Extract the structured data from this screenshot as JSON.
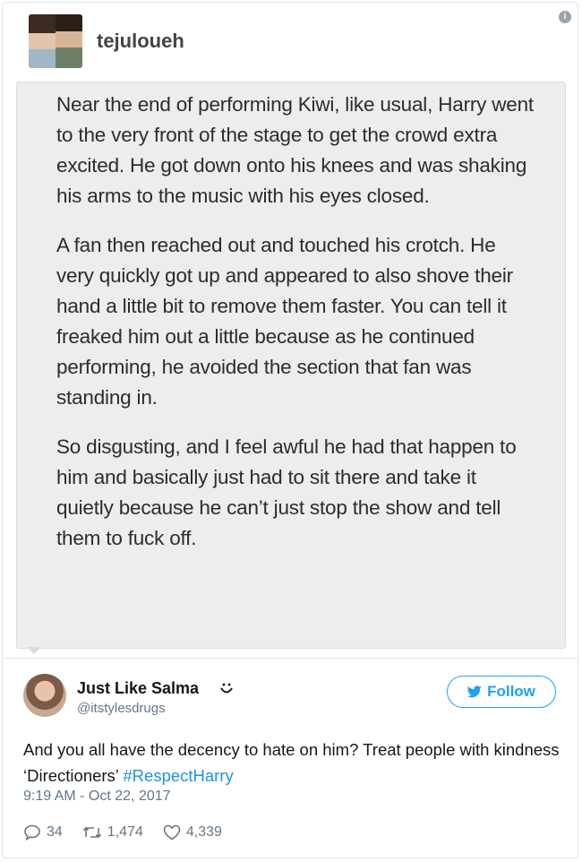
{
  "tumblr_post": {
    "username": "tejuloueh",
    "info_glyph": "i",
    "paragraphs": [
      "Near the end of performing Kiwi, like usual, Harry went to the very front of the stage to get the crowd extra excited. He got down onto his knees and was shaking his arms to the music with his eyes closed.",
      "A fan then reached out and touched his crotch. He very quickly got up and appeared to also shove their hand a little bit to remove them faster. You can tell it freaked him out a little because as he continued performing, he avoided the section that fan was standing in.",
      "So disgusting, and I feel awful he had that happen to him and basically just had to sit there and take it quietly because he can’t just stop the show and tell them to fuck off."
    ]
  },
  "tweet": {
    "display_name": "Just Like Salma",
    "handle": "@itstylesdrugs",
    "follow_label": "Follow",
    "text_main": "And you all have the decency to hate on him? Treat people with kindness ‘Directioners’ ",
    "hashtag": "#RespectHarry",
    "timestamp": "9:19 AM - Oct 22, 2017",
    "replies": "34",
    "retweets": "1,474",
    "likes": "4,339"
  },
  "icons": [
    "info-icon",
    "smile-icon",
    "twitter-bird-icon",
    "reply-icon",
    "retweet-icon",
    "like-icon"
  ],
  "colors": {
    "twitter_blue": "#1da1f2",
    "hashtag": "#1b95e0",
    "muted": "#657786",
    "quote_bg": "#ededed"
  }
}
